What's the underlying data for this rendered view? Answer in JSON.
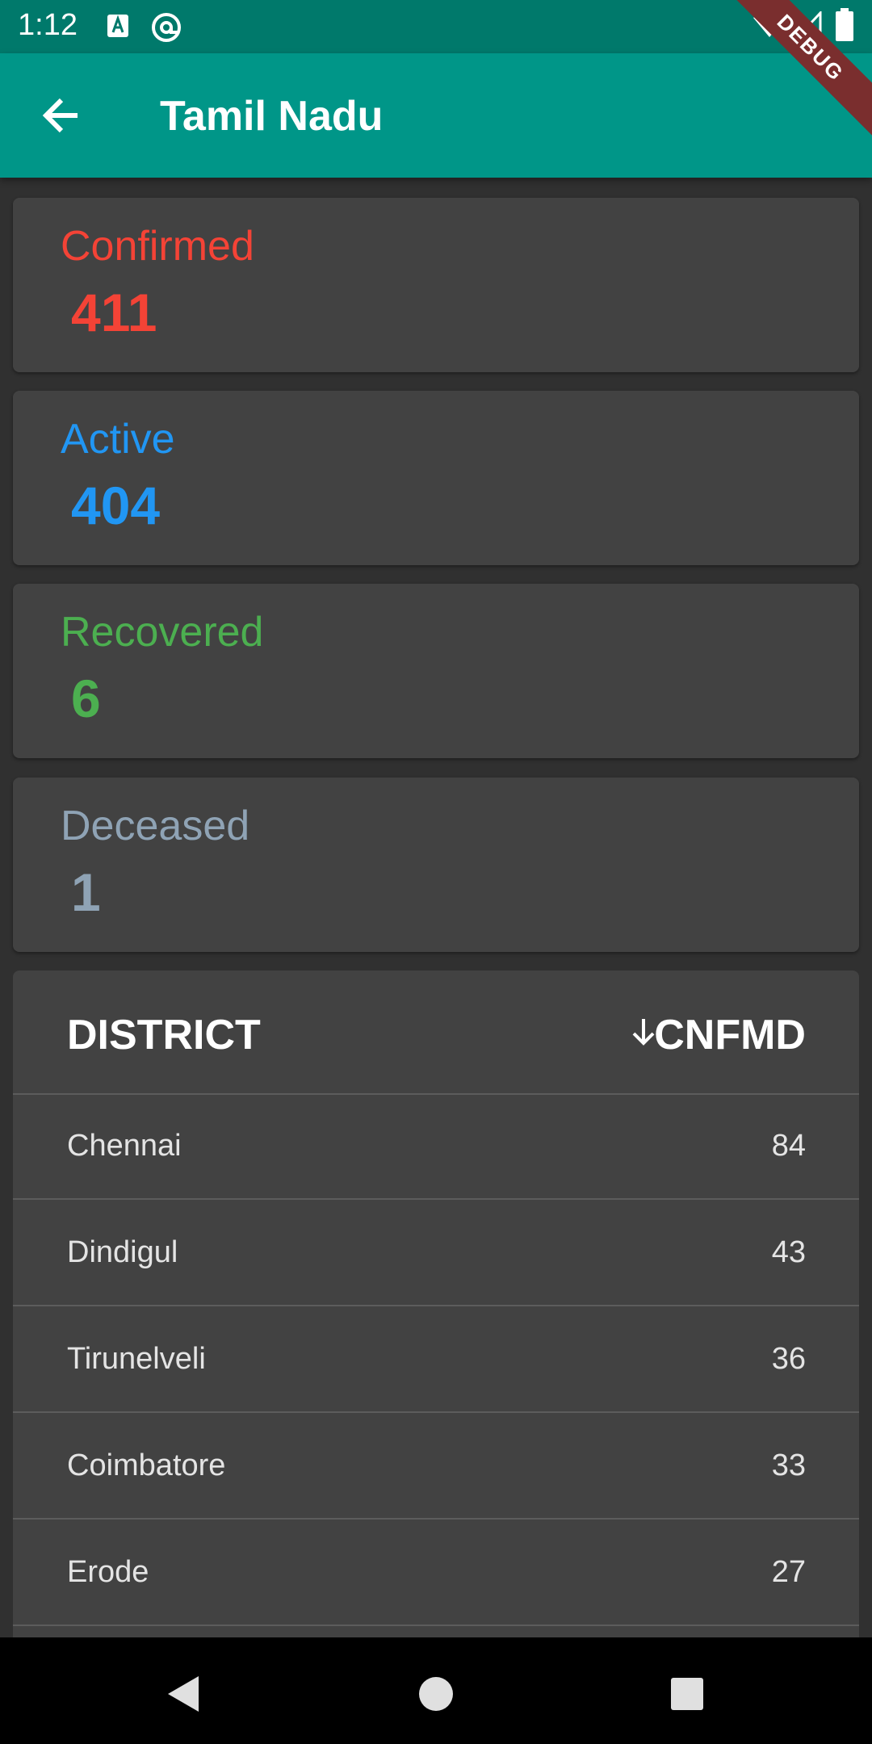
{
  "status_bar": {
    "time": "1:12",
    "icons": [
      "a-badge-icon",
      "at-sign-icon",
      "wifi-icon",
      "signal-icon",
      "battery-icon"
    ]
  },
  "app_bar": {
    "title": "Tamil Nadu",
    "back_icon": "arrow-back-icon",
    "debug_label": "DEBUG",
    "color": "#009688"
  },
  "stats": [
    {
      "label": "Confirmed",
      "value": "411",
      "color": "#f44336"
    },
    {
      "label": "Active",
      "value": "404",
      "color": "#2196f3"
    },
    {
      "label": "Recovered",
      "value": "6",
      "color": "#4caf50"
    },
    {
      "label": "Deceased",
      "value": "1",
      "color": "#8fa3b5"
    }
  ],
  "table": {
    "headers": {
      "district": "DISTRICT",
      "count": "CNFMD"
    },
    "sort_icon": "arrow-down-icon",
    "rows": [
      {
        "district": "Chennai",
        "count": "84"
      },
      {
        "district": "Dindigul",
        "count": "43"
      },
      {
        "district": "Tirunelveli",
        "count": "36"
      },
      {
        "district": "Coimbatore",
        "count": "33"
      },
      {
        "district": "Erode",
        "count": "27"
      }
    ]
  },
  "nav_bar": {
    "icons": [
      "back-triangle-icon",
      "home-circle-icon",
      "recents-square-icon"
    ]
  }
}
